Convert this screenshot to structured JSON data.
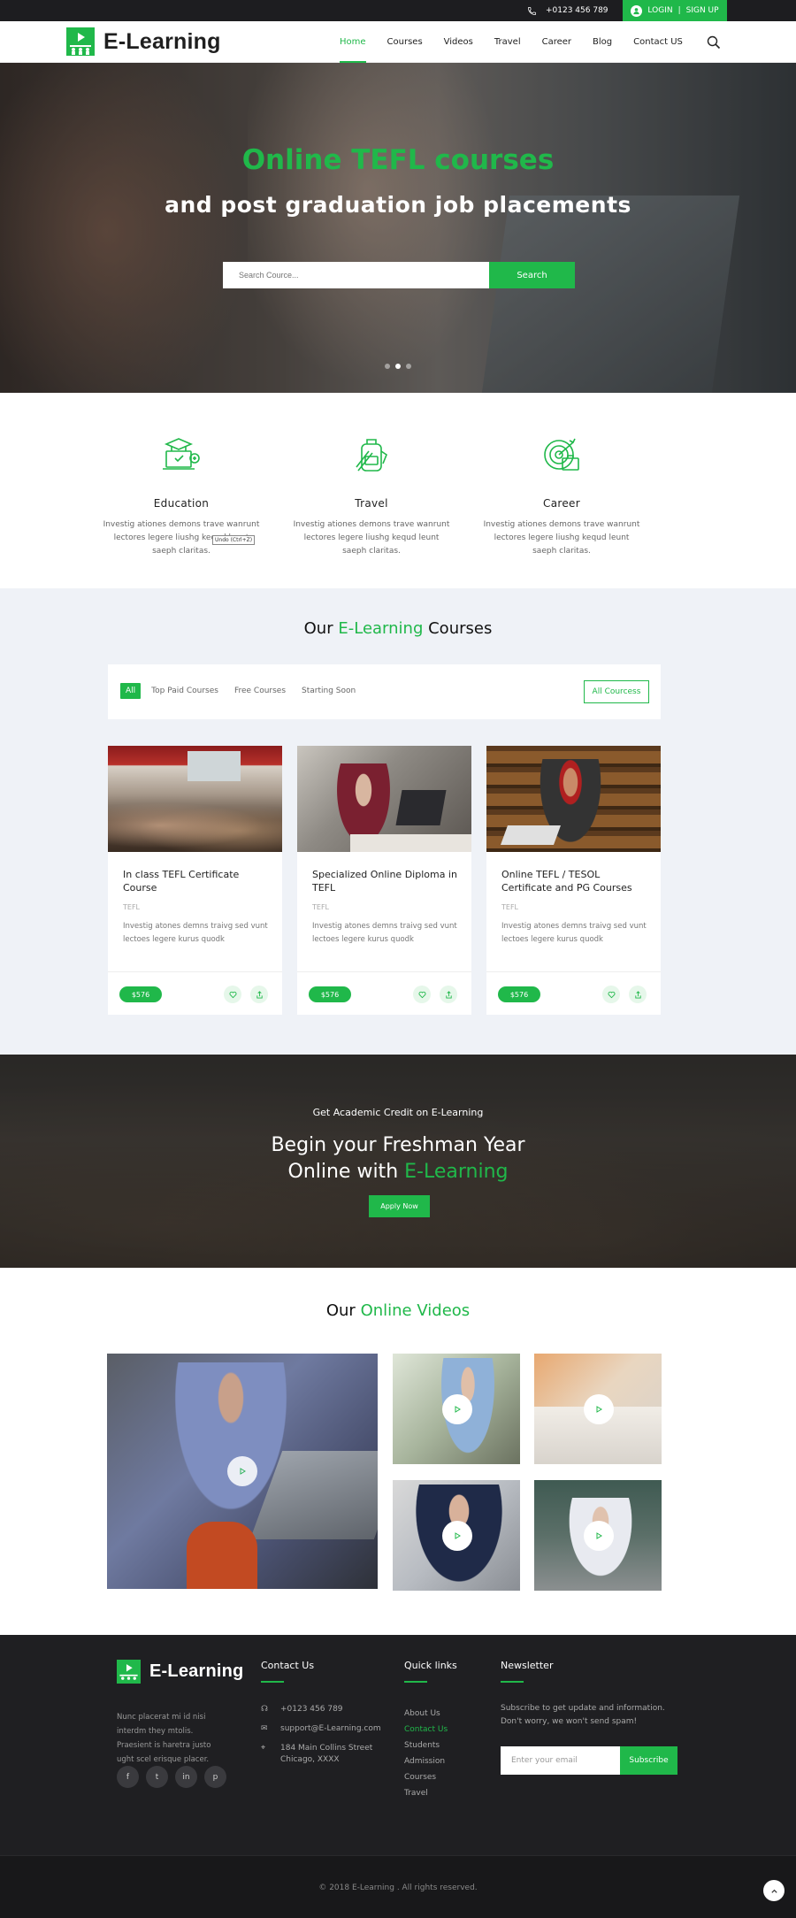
{
  "topbar": {
    "phone": "+0123 456 789",
    "login": "LOGIN",
    "separator": "|",
    "signup": "SIGN UP"
  },
  "brand": {
    "name": "E-Learning"
  },
  "nav": {
    "items": [
      "Home",
      "Courses",
      "Videos",
      "Travel",
      "Career",
      "Blog",
      "Contact US"
    ],
    "active": "Home"
  },
  "hero": {
    "title": "Online TEFL courses",
    "subtitle": "and post graduation job placements",
    "search_placeholder": "Search Cource...",
    "search_button": "Search",
    "slides": 3,
    "active_slide": 2
  },
  "features": [
    {
      "title": "Education",
      "text": "Investig ationes demons trave wanrunt lectores legere liushg kequd leunt saeph claritas.",
      "icon": "education-icon"
    },
    {
      "title": "Travel",
      "text": "Investig ationes demons trave wanrunt lectores legere liushg kequd leunt saeph claritas.",
      "icon": "backpack-icon"
    },
    {
      "title": "Career",
      "text": "Investig ationes demons trave wanrunt lectores legere liushg kequd leunt saeph claritas.",
      "icon": "career-target-icon"
    }
  ],
  "tooltip": "Undo (Ctrl+Z)",
  "courses": {
    "title_pre": "Our",
    "title_accent": "E-Learning",
    "title_post": "Courses",
    "filters": [
      "All",
      "Top Paid Courses",
      "Free Courses",
      "Starting Soon"
    ],
    "all_button": "All Courcess",
    "cards": [
      {
        "title": "In class TEFL Certificate Course",
        "tag": "TEFL",
        "desc": "Investig atones demns traivg sed vunt lectoes legere kurus quodk",
        "price": "$576"
      },
      {
        "title": "Specialized Online Diploma in TEFL",
        "tag": "TEFL",
        "desc": "Investig atones demns traivg sed vunt lectoes legere kurus quodk",
        "price": "$576"
      },
      {
        "title": "Online TEFL / TESOL Certificate and PG Courses",
        "tag": "TEFL",
        "desc": "Investig atones demns traivg sed vunt lectoes legere kurus quodk",
        "price": "$576"
      }
    ]
  },
  "credit": {
    "subtitle": "Get Academic Credit on E-Learning",
    "line1": "Begin your Freshman Year",
    "line2_pre": "Online with",
    "line2_accent": "E-Learning",
    "button": "Apply Now"
  },
  "videos": {
    "title_pre": "Our",
    "title_accent": "Online Videos"
  },
  "footer": {
    "about": "Nunc placerat mi id nisi interdm they mtolis. Praesient is haretra justo ught scel erisque placer.",
    "social": [
      "f",
      "t",
      "in",
      "p"
    ],
    "contact_title": "Contact Us",
    "phone": "+0123 456 789",
    "email": "support@E-Learning.com",
    "address1": "184 Main Collins Street",
    "address2": "Chicago, XXXX",
    "quick_title": "Quick links",
    "links": [
      "About Us",
      "Contact Us",
      "Students",
      "Admission",
      "Courses",
      "Travel"
    ],
    "active_link": "Contact Us",
    "news_title": "Newsletter",
    "news_text": "Subscribe to get update and information. Don't worry, we won't send spam!",
    "email_placeholder": "Enter your email",
    "subscribe": "Subscribe"
  },
  "copyright": "© 2018 E-Learning . All rights reserved.",
  "colors": {
    "accent": "#20b84a",
    "dark": "#1f1f22"
  }
}
